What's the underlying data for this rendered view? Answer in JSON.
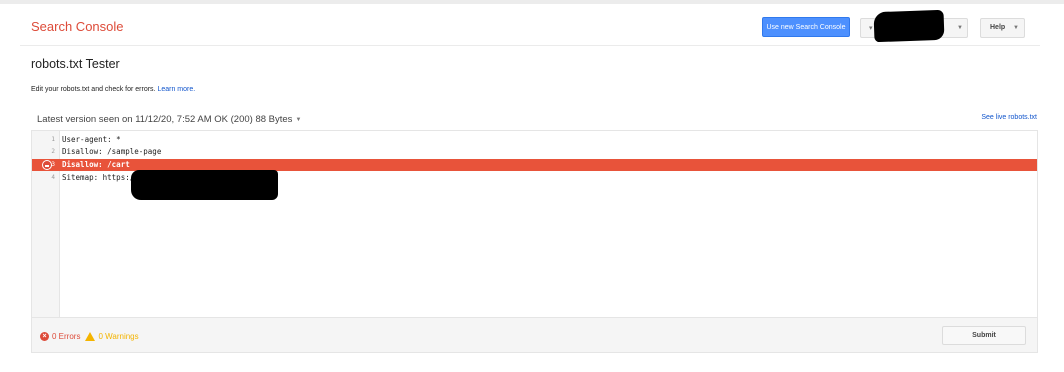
{
  "header": {
    "brand": "Search Console",
    "new_console_button": "Use new Search Console",
    "help_button": "Help"
  },
  "page": {
    "title": "robots.txt Tester",
    "description": "Edit your robots.txt and check for errors.",
    "learn_more": "Learn more.",
    "version_text": "Latest version seen on 11/12/20, 7:52 AM OK (200) 88 Bytes",
    "see_live": "See live robots.txt"
  },
  "editor": {
    "lines": [
      {
        "num": "1",
        "code": "User-agent: *"
      },
      {
        "num": "2",
        "code": "Disallow: /sample-page"
      },
      {
        "num": "3",
        "code": "Disallow: /cart"
      },
      {
        "num": "4",
        "code": "Sitemap: https:/"
      }
    ]
  },
  "footer": {
    "errors": "0 Errors",
    "warnings": "0 Warnings",
    "submit_button": "Submit"
  },
  "colors": {
    "brand": "#dd4b39",
    "primary_button": "#4d90fe",
    "error_line": "#e8533a",
    "warning": "#f4b400",
    "link": "#1155cc"
  }
}
